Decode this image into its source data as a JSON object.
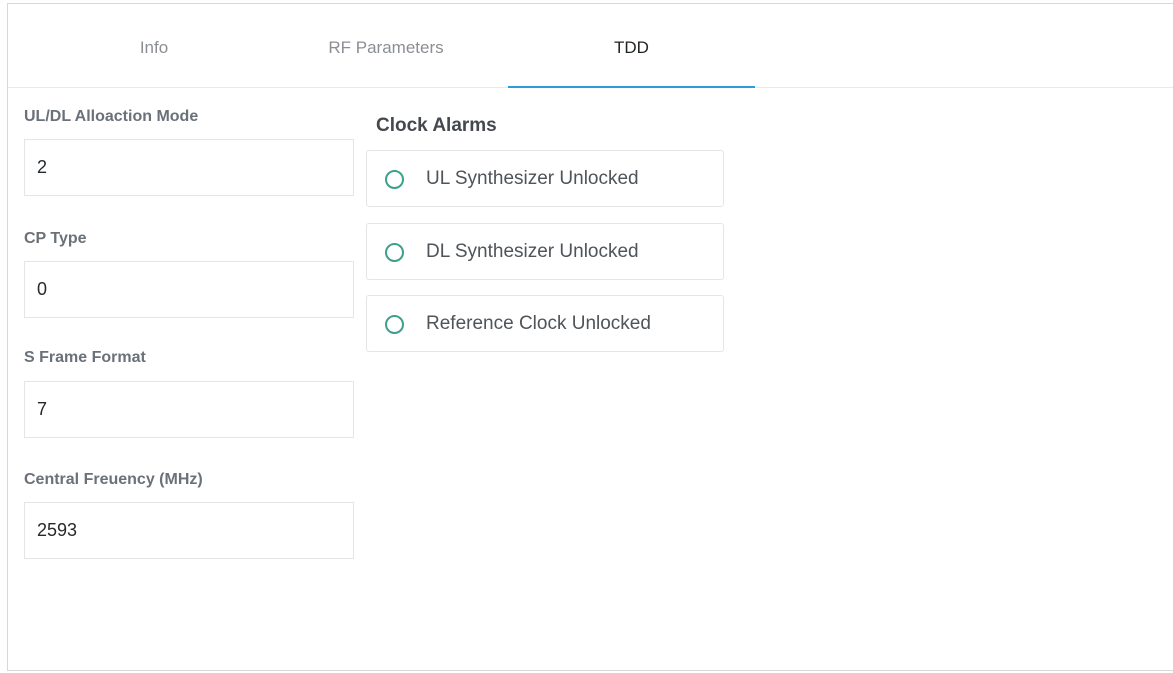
{
  "tabs": [
    {
      "label": "Info",
      "active": false
    },
    {
      "label": "RF Parameters",
      "active": false
    },
    {
      "label": "TDD",
      "active": true
    }
  ],
  "fields": [
    {
      "label": "UL/DL Alloaction Mode",
      "value": "2"
    },
    {
      "label": "CP Type",
      "value": "0"
    },
    {
      "label": "S Frame Format",
      "value": "7"
    },
    {
      "label": "Central Freuency (MHz)",
      "value": "2593"
    }
  ],
  "clock_alarms": {
    "title": "Clock Alarms",
    "items": [
      {
        "label": "UL Synthesizer Unlocked",
        "state": "off"
      },
      {
        "label": "DL Synthesizer Unlocked",
        "state": "off"
      },
      {
        "label": "Reference Clock Unlocked",
        "state": "off"
      }
    ],
    "indicator_color": "#3da08c"
  },
  "colors": {
    "accent": "#2d9cdb"
  }
}
